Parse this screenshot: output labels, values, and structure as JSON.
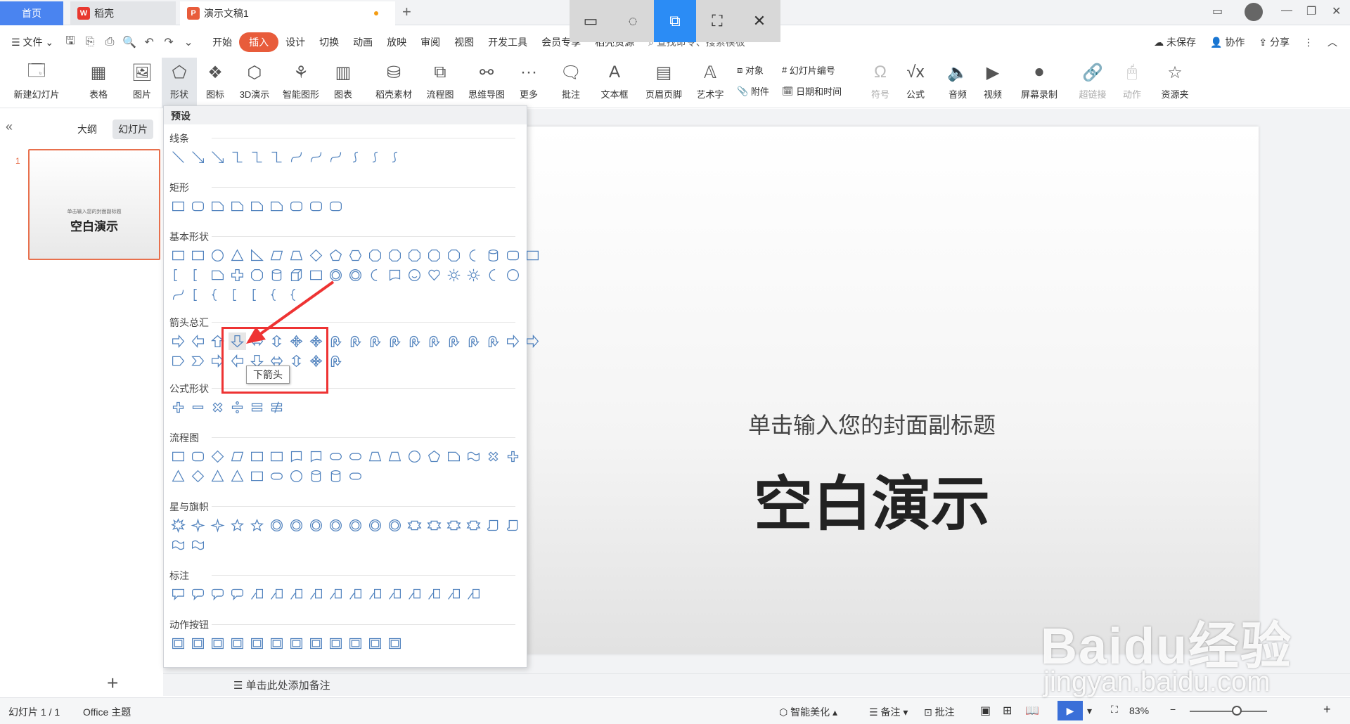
{
  "tabs": {
    "home": "首页",
    "daoke": "稻壳",
    "doc": "演示文稿1",
    "plus": "+"
  },
  "menu": {
    "file": "文件",
    "items": [
      "开始",
      "插入",
      "设计",
      "切换",
      "动画",
      "放映",
      "审阅",
      "视图",
      "开发工具",
      "会员专享",
      "稻壳资源"
    ],
    "active": "插入",
    "search": "查找命令、搜索模板",
    "unsaved": "未保存",
    "collab": "协作",
    "share": "分享"
  },
  "ribbon": {
    "new_slide": "新建幻灯片",
    "table": "表格",
    "picture": "图片",
    "shape": "形状",
    "icon": "图标",
    "threed": "3D演示",
    "smartart": "智能图形",
    "chart": "图表",
    "material": "稻壳素材",
    "flow": "流程图",
    "mind": "思维导图",
    "more": "更多",
    "comment": "批注",
    "textbox": "文本框",
    "header": "页眉页脚",
    "wordart": "艺术字",
    "object": "对象",
    "slidenum": "幻灯片编号",
    "attach": "附件",
    "datetime": "日期和时间",
    "symbol": "符号",
    "formula": "公式",
    "audio": "音频",
    "video": "视频",
    "screenrec": "屏幕录制",
    "hyperlink": "超链接",
    "action": "动作",
    "resources": "资源夹"
  },
  "left": {
    "outline": "大纲",
    "slides": "幻灯片",
    "slide_num": "1",
    "thumb_sub": "单击输入您的封面副标题",
    "thumb_title": "空白演示",
    "add": "+"
  },
  "slide": {
    "subtitle": "单击输入您的封面副标题",
    "title": "空白演示"
  },
  "notes": "单击此处添加备注",
  "dropdown": {
    "preset": "预设",
    "cats": [
      "线条",
      "矩形",
      "基本形状",
      "箭头总汇",
      "公式形状",
      "流程图",
      "星与旗帜",
      "标注",
      "动作按钮"
    ],
    "tooltip": "下箭头"
  },
  "status": {
    "slide": "幻灯片 1 / 1",
    "theme": "Office 主题",
    "beautify": "智能美化",
    "notes": "备注",
    "comment": "批注",
    "zoom": "83%"
  },
  "watermark": {
    "brand": "Baidu经验",
    "url": "jingyan.baidu.com"
  }
}
